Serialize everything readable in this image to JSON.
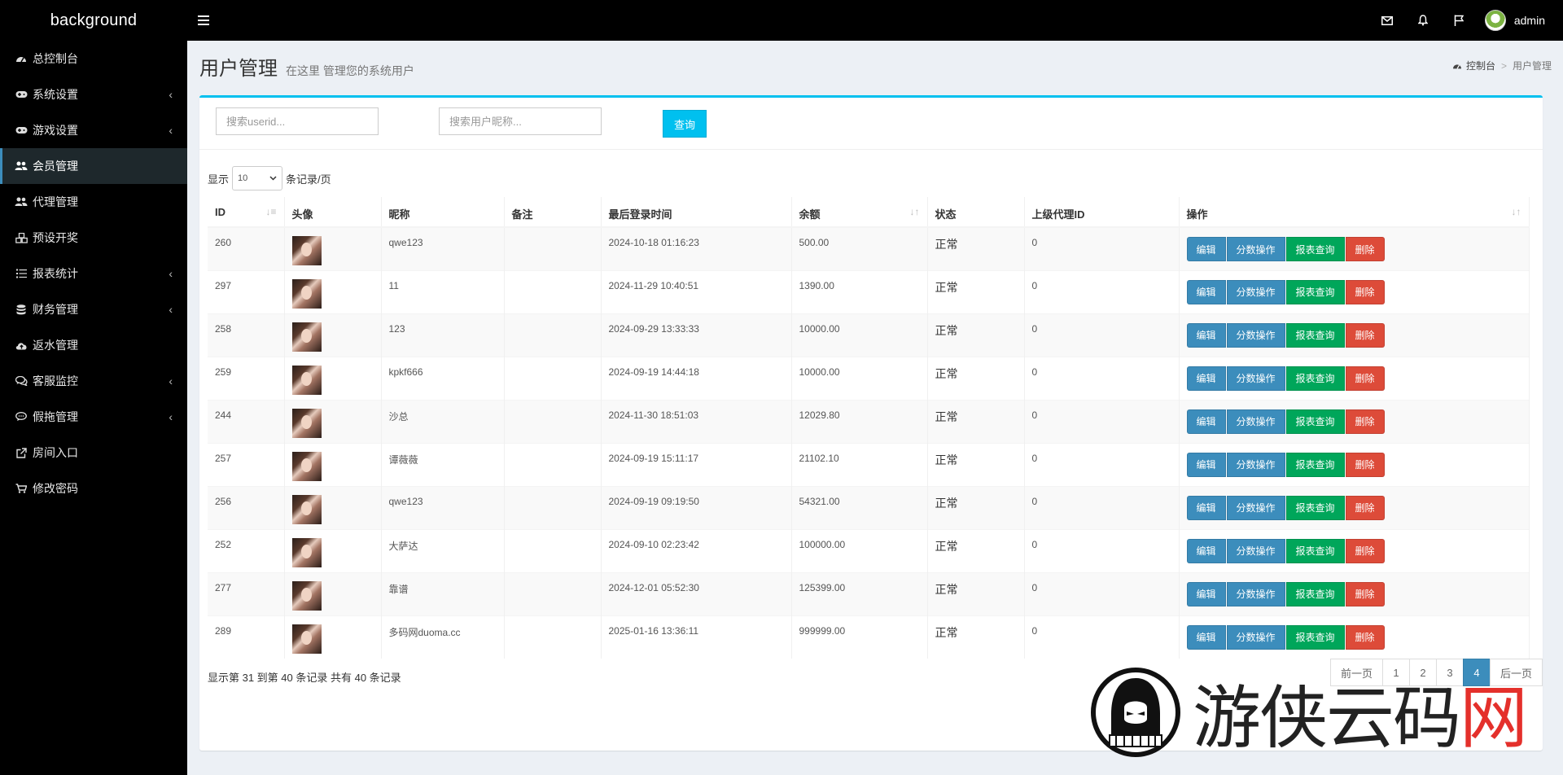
{
  "header": {
    "brand": "background",
    "user_name": "admin",
    "icons": [
      "envelope-icon",
      "bell-icon",
      "flag-icon"
    ]
  },
  "sidebar": {
    "items": [
      {
        "label": "总控制台",
        "icon": "dashboard-icon",
        "has_submenu": false
      },
      {
        "label": "系统设置",
        "icon": "gamepad-icon",
        "has_submenu": true
      },
      {
        "label": "游戏设置",
        "icon": "gamepad-icon",
        "has_submenu": true
      },
      {
        "label": "会员管理",
        "icon": "users-icon",
        "has_submenu": false,
        "active": true
      },
      {
        "label": "代理管理",
        "icon": "users-icon",
        "has_submenu": false
      },
      {
        "label": "预设开奖",
        "icon": "cubes-icon",
        "has_submenu": false
      },
      {
        "label": "报表统计",
        "icon": "list-icon",
        "has_submenu": true
      },
      {
        "label": "财务管理",
        "icon": "database-icon",
        "has_submenu": true
      },
      {
        "label": "返水管理",
        "icon": "cloud-upload-icon",
        "has_submenu": false
      },
      {
        "label": "客服监控",
        "icon": "comments-icon",
        "has_submenu": true
      },
      {
        "label": "假拖管理",
        "icon": "comment-icon",
        "has_submenu": true
      },
      {
        "label": "房间入口",
        "icon": "external-link-icon",
        "has_submenu": false
      },
      {
        "label": "修改密码",
        "icon": "cart-icon",
        "has_submenu": false
      }
    ]
  },
  "page": {
    "title": "用户管理",
    "subtitle": "在这里 管理您的系统用户",
    "breadcrumb": [
      "控制台",
      "用户管理"
    ]
  },
  "search": {
    "userid_placeholder": "搜索userid...",
    "nickname_placeholder": "搜索用户昵称...",
    "query_label": "查询"
  },
  "length": {
    "prefix": "显示",
    "value": "10",
    "suffix": "条记录/页"
  },
  "table": {
    "headers": [
      "ID",
      "头像",
      "昵称",
      "备注",
      "最后登录时间",
      "余额",
      "状态",
      "上级代理ID",
      "操作"
    ],
    "action_labels": {
      "edit": "编辑",
      "score": "分数操作",
      "report": "报表查询",
      "delete": "删除"
    },
    "rows": [
      {
        "id": "260",
        "nickname": "qwe123",
        "remark": "",
        "last_login": "2024-10-18 01:16:23",
        "balance": "500.00",
        "status": "正常",
        "parent_id": "0"
      },
      {
        "id": "297",
        "nickname": "11",
        "remark": "",
        "last_login": "2024-11-29 10:40:51",
        "balance": "1390.00",
        "status": "正常",
        "parent_id": "0"
      },
      {
        "id": "258",
        "nickname": "123",
        "remark": "",
        "last_login": "2024-09-29 13:33:33",
        "balance": "10000.00",
        "status": "正常",
        "parent_id": "0"
      },
      {
        "id": "259",
        "nickname": "kpkf666",
        "remark": "",
        "last_login": "2024-09-19 14:44:18",
        "balance": "10000.00",
        "status": "正常",
        "parent_id": "0"
      },
      {
        "id": "244",
        "nickname": "沙总",
        "remark": "",
        "last_login": "2024-11-30 18:51:03",
        "balance": "12029.80",
        "status": "正常",
        "parent_id": "0"
      },
      {
        "id": "257",
        "nickname": "谭薇薇",
        "remark": "",
        "last_login": "2024-09-19 15:11:17",
        "balance": "21102.10",
        "status": "正常",
        "parent_id": "0"
      },
      {
        "id": "256",
        "nickname": "qwe123",
        "remark": "",
        "last_login": "2024-09-19 09:19:50",
        "balance": "54321.00",
        "status": "正常",
        "parent_id": "0"
      },
      {
        "id": "252",
        "nickname": "大萨达",
        "remark": "",
        "last_login": "2024-09-10 02:23:42",
        "balance": "100000.00",
        "status": "正常",
        "parent_id": "0"
      },
      {
        "id": "277",
        "nickname": "靠谱",
        "remark": "",
        "last_login": "2024-12-01 05:52:30",
        "balance": "125399.00",
        "status": "正常",
        "parent_id": "0"
      },
      {
        "id": "289",
        "nickname": "多码网duoma.cc",
        "remark": "",
        "last_login": "2025-01-16 13:36:11",
        "balance": "999999.00",
        "status": "正常",
        "parent_id": "0"
      }
    ]
  },
  "footer": {
    "info": "显示第 31 到第 40 条记录 共有 40 条记录",
    "pager": [
      {
        "label": "前一页",
        "active": false
      },
      {
        "label": "1",
        "active": false
      },
      {
        "label": "2",
        "active": false
      },
      {
        "label": "3",
        "active": false
      },
      {
        "label": "4",
        "active": true
      },
      {
        "label": "后一页",
        "active": false
      }
    ]
  },
  "watermark": {
    "text": "游侠云码网",
    "accent_char": "网"
  },
  "colors": {
    "accent": "#00c0ef",
    "primary": "#3c8dbc",
    "success": "#00a65a",
    "danger": "#dd4b39",
    "sidebar_bg": "#000000"
  }
}
